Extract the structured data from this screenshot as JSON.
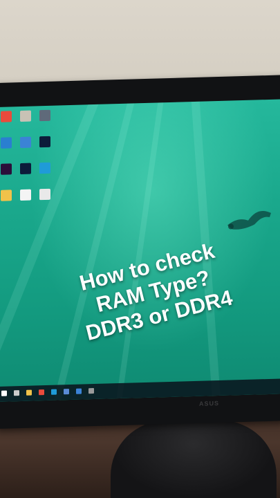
{
  "headline": {
    "line1": "How to check",
    "line2": "RAM Type?",
    "line3": "DDR3 or DDR4"
  },
  "monitor": {
    "brand": "ASUS"
  },
  "desktop_icons": [
    {
      "name": "solitaire-icon",
      "label": "",
      "color": "#e94b3c"
    },
    {
      "name": "icon-2",
      "label": "",
      "color": "#c8c2b5"
    },
    {
      "name": "icon-3",
      "label": "",
      "color": "#5f6a7a"
    },
    {
      "name": "icon-4",
      "label": "",
      "color": "#2a7fd0"
    },
    {
      "name": "icon-5",
      "label": "",
      "color": "#3b83d6"
    },
    {
      "name": "photoshop-icon",
      "label": "",
      "color": "#0c1c3a"
    },
    {
      "name": "premiere-icon",
      "label": "",
      "color": "#2b0f3a"
    },
    {
      "name": "photoshop-2-icon",
      "label": "",
      "color": "#0c1c3a"
    },
    {
      "name": "edge-icon",
      "label": "",
      "color": "#1f9bd8"
    },
    {
      "name": "folder-icon",
      "label": "",
      "color": "#f0c24a"
    },
    {
      "name": "cap-icon",
      "label": "",
      "color": "#f4f4f4"
    },
    {
      "name": "file-icon",
      "label": "",
      "color": "#e9e9e9"
    }
  ],
  "taskbar": {
    "icons": [
      {
        "name": "start-icon",
        "color": "#ffffff"
      },
      {
        "name": "search-icon",
        "color": "#cccccc"
      },
      {
        "name": "file-explorer-icon",
        "color": "#f0c24a"
      },
      {
        "name": "chrome-icon",
        "color": "#e94b3c"
      },
      {
        "name": "edge-taskbar-icon",
        "color": "#1f9bd8"
      },
      {
        "name": "store-icon",
        "color": "#5a8bd6"
      },
      {
        "name": "mail-icon",
        "color": "#3b83d6"
      },
      {
        "name": "app-icon",
        "color": "#9a9a9a"
      }
    ]
  }
}
